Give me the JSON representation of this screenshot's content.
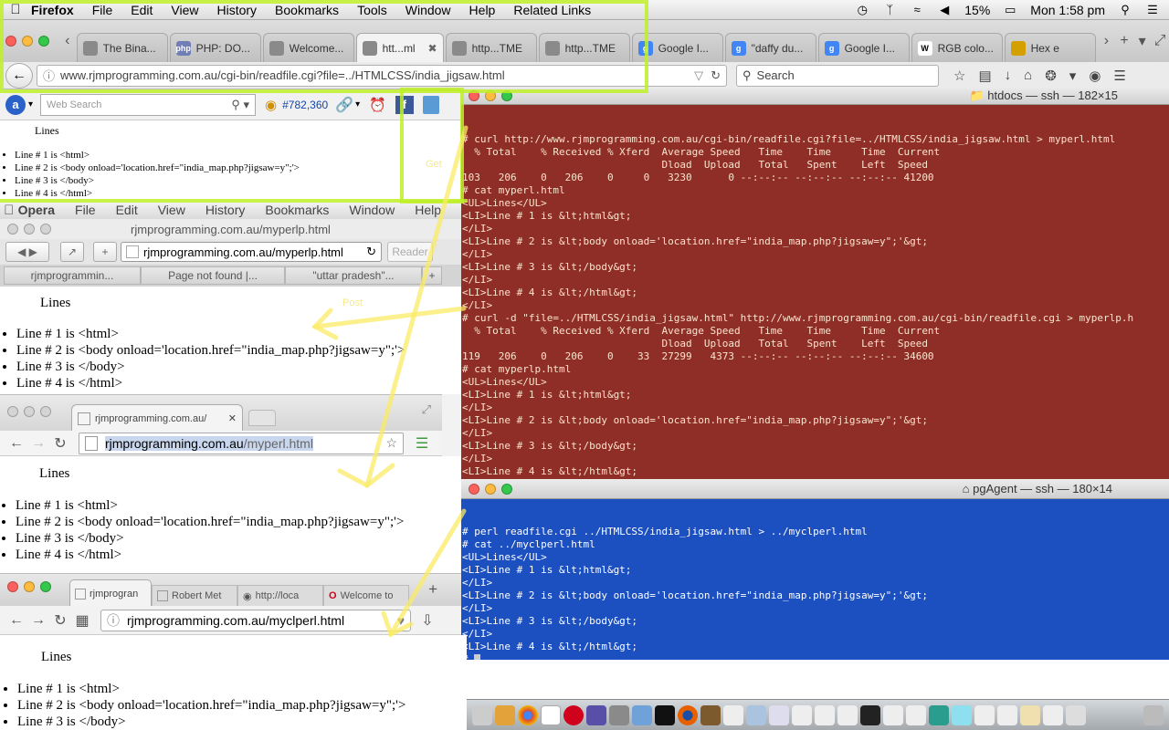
{
  "menubar": {
    "app": "Firefox",
    "items": [
      "File",
      "Edit",
      "View",
      "History",
      "Bookmarks",
      "Tools",
      "Window",
      "Help",
      "Related Links"
    ],
    "battery": "15%",
    "clock": "Mon 1:58 pm"
  },
  "firefox": {
    "tabs": [
      {
        "title": "The Bina...",
        "icon": "page-icon",
        "color": "#8a8a8a"
      },
      {
        "title": "PHP: DO...",
        "icon": "php-icon",
        "color": "#6f7fb5"
      },
      {
        "title": "Welcome...",
        "icon": "page-icon",
        "color": "#8a8a8a"
      },
      {
        "title": "htt...ml",
        "icon": "page-icon",
        "color": "#8a8a8a",
        "active": true
      },
      {
        "title": "http...TME",
        "icon": "page-icon",
        "color": "#8a8a8a"
      },
      {
        "title": "http...TME",
        "icon": "page-icon",
        "color": "#8a8a8a"
      },
      {
        "title": "Google I...",
        "icon": "google-icon",
        "color": "#4285f4"
      },
      {
        "title": "\"daffy du...",
        "icon": "google-icon",
        "color": "#4285f4"
      },
      {
        "title": "Google I...",
        "icon": "google-icon",
        "color": "#4285f4"
      },
      {
        "title": "RGB colo...",
        "icon": "wikipedia-icon",
        "color": "#222222"
      },
      {
        "title": "Hex e",
        "icon": "globe-icon",
        "color": "#d4a000"
      }
    ],
    "url": "www.rjmprogramming.com.au/cgi-bin/readfile.cgi?file=../HTMLCSS/india_jigsaw.html",
    "search_placeholder": "Search",
    "web_search_placeholder": "Web Search",
    "count": "#782,360",
    "page_heading": "Lines",
    "lines": [
      "Line # 1 is <html>",
      "Line # 2 is <body onload='location.href=\"india_map.php?jigsaw=y\";'>",
      "Line # 3 is </body>",
      "Line # 4 is </html>"
    ]
  },
  "terminal_red": {
    "title": "htdocs — ssh — 182×15",
    "lines": [
      "# curl http://www.rjmprogramming.com.au/cgi-bin/readfile.cgi?file=../HTMLCSS/india_jigsaw.html > myperl.html",
      "  % Total    % Received % Xferd  Average Speed   Time    Time     Time  Current",
      "                                 Dload  Upload   Total   Spent    Left  Speed",
      "103   206    0   206    0     0   3230      0 --:--:-- --:--:-- --:--:-- 41200",
      "# cat myperl.html",
      "<UL>Lines</UL>",
      "<LI>Line # 1 is &lt;html&gt;",
      "</LI>",
      "<LI>Line # 2 is &lt;body onload='location.href=\"india_map.php?jigsaw=y\";'&gt;",
      "</LI>",
      "<LI>Line # 3 is &lt;/body&gt;",
      "</LI>",
      "<LI>Line # 4 is &lt;/html&gt;",
      "</LI>",
      "# curl -d \"file=../HTMLCSS/india_jigsaw.html\" http://www.rjmprogramming.com.au/cgi-bin/readfile.cgi > myperlp.h",
      "  % Total    % Received % Xferd  Average Speed   Time    Time     Time  Current",
      "                                 Dload  Upload   Total   Spent    Left  Speed",
      "119   206    0   206    0    33  27299   4373 --:--:-- --:--:-- --:--:-- 34600",
      "# cat myperlp.html",
      "<UL>Lines</UL>",
      "<LI>Line # 1 is &lt;html&gt;",
      "</LI>",
      "<LI>Line # 2 is &lt;body onload='location.href=\"india_map.php?jigsaw=y\";'&gt;",
      "</LI>",
      "<LI>Line # 3 is &lt;/body&gt;",
      "</LI>",
      "<LI>Line # 4 is &lt;/html&gt;",
      "</LI>",
      "#"
    ]
  },
  "terminal_blue": {
    "title": "pgAgent — ssh — 180×14",
    "lines": [
      "# perl readfile.cgi ../HTMLCSS/india_jigsaw.html > ../myclperl.html",
      "# cat ../myclperl.html",
      "<UL>Lines</UL>",
      "<LI>Line # 1 is &lt;html&gt;",
      "</LI>",
      "<LI>Line # 2 is &lt;body onload='location.href=\"india_map.php?jigsaw=y\";'&gt;",
      "</LI>",
      "<LI>Line # 3 is &lt;/body&gt;",
      "</LI>",
      "<LI>Line # 4 is &lt;/html&gt;",
      "# "
    ]
  },
  "opera": {
    "app": "Opera",
    "menu": [
      "File",
      "Edit",
      "View",
      "History",
      "Bookmarks",
      "Window",
      "Help"
    ],
    "window_title": "rjmprogramming.com.au/myperlp.html",
    "url": "rjmprogramming.com.au/myperlp.html",
    "reader": "Reader",
    "tabs": [
      "rjmprogrammin...",
      "Page not found |...",
      "\"uttar pradesh\"..."
    ]
  },
  "chrome": {
    "tab_title": "rjmprogramming.com.au/",
    "url_host": "rjmprogramming.com.au",
    "url_path": "/myperl.html"
  },
  "opera2": {
    "tabs": [
      "rjmprogran",
      "Robert Met",
      "http://loca",
      "Welcome to"
    ],
    "url": "rjmprogramming.com.au/myclperl.html"
  },
  "annotations": {
    "get": "Get",
    "post": "Post"
  }
}
